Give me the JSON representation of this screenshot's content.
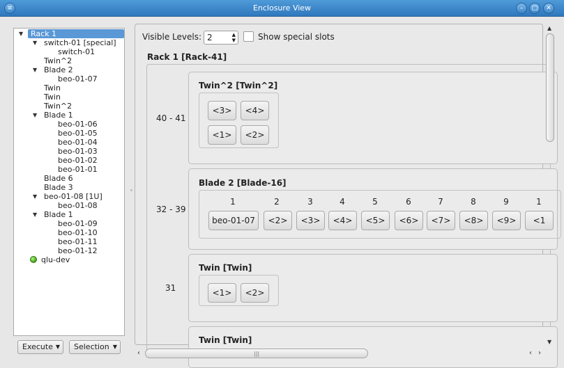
{
  "window": {
    "title": "Enclosure View",
    "controls": [
      "menu-icon",
      "minimize-icon",
      "maximize-icon",
      "close-icon"
    ]
  },
  "tree": {
    "items": [
      {
        "label": "Rack 1",
        "level": 0,
        "expanded": true,
        "selected": true
      },
      {
        "label": "switch-01 [special]",
        "level": 1,
        "expanded": true
      },
      {
        "label": "switch-01",
        "level": 2
      },
      {
        "label": "Twin^2",
        "level": 1
      },
      {
        "label": "Blade 2",
        "level": 1,
        "expanded": true
      },
      {
        "label": "beo-01-07",
        "level": 2
      },
      {
        "label": "Twin",
        "level": 1
      },
      {
        "label": "Twin",
        "level": 1
      },
      {
        "label": "Twin^2",
        "level": 1
      },
      {
        "label": "Blade 1",
        "level": 1,
        "expanded": true
      },
      {
        "label": "beo-01-06",
        "level": 2
      },
      {
        "label": "beo-01-05",
        "level": 2
      },
      {
        "label": "beo-01-04",
        "level": 2
      },
      {
        "label": "beo-01-03",
        "level": 2
      },
      {
        "label": "beo-01-02",
        "level": 2
      },
      {
        "label": "beo-01-01",
        "level": 2
      },
      {
        "label": "Blade 6",
        "level": 1
      },
      {
        "label": "Blade 3",
        "level": 1
      },
      {
        "label": "beo-01-08 [1U]",
        "level": 1,
        "expanded": true
      },
      {
        "label": "beo-01-08",
        "level": 2
      },
      {
        "label": "Blade 1",
        "level": 1,
        "expanded": true
      },
      {
        "label": "beo-01-09",
        "level": 2
      },
      {
        "label": "beo-01-10",
        "level": 2
      },
      {
        "label": "beo-01-11",
        "level": 2
      },
      {
        "label": "beo-01-12",
        "level": 2
      },
      {
        "label": "qlu-dev",
        "level": 0,
        "status": "online",
        "status_color": "#3fa315"
      }
    ]
  },
  "bottom_buttons": {
    "execute": "Execute",
    "selection": "Selection"
  },
  "controls": {
    "visible_levels_label": "Visible Levels:",
    "visible_levels_value": "2",
    "show_special_label": "Show special slots",
    "show_special_checked": false
  },
  "rack": {
    "title": "Rack 1 [Rack-41]",
    "groups": [
      {
        "range": "40 - 41",
        "title": "Twin^2 [Twin^2]",
        "slots": [
          "<3>",
          "<4>",
          "<1>",
          "<2>"
        ]
      },
      {
        "range": "32 - 39",
        "title": "Blade 2 [Blade-16]",
        "columns": [
          "1",
          "2",
          "3",
          "4",
          "5",
          "6",
          "7",
          "8",
          "9",
          "1"
        ],
        "slots": [
          "beo-01-07",
          "<2>",
          "<3>",
          "<4>",
          "<5>",
          "<6>",
          "<7>",
          "<8>",
          "<9>",
          "<1"
        ]
      },
      {
        "range": "31",
        "title": "Twin [Twin]",
        "slots": [
          "<1>",
          "<2>"
        ]
      },
      {
        "range": "",
        "title": "Twin [Twin]",
        "slots": []
      }
    ]
  },
  "colors": {
    "titlebar": "#3a86cc",
    "selection": "#5a98d6",
    "background": "#e7e7e7"
  }
}
